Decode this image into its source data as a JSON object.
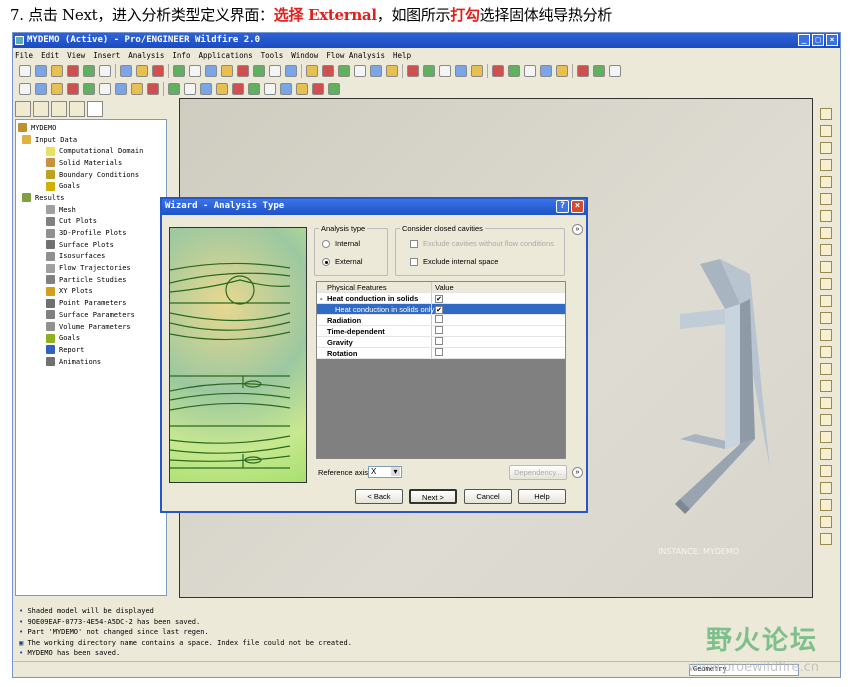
{
  "caption": {
    "prefix": "7. 点击 Next，进入分析类型定义界面：",
    "hl1": "选择 External",
    "mid": "，如图所示",
    "hl2": "打勾",
    "suffix": "选择固体纯导热分析"
  },
  "window": {
    "title": "MYDEMO (Active) - Pro/ENGINEER Wildfire 2.0",
    "controls": [
      "_",
      "□",
      "×"
    ]
  },
  "menu": [
    "File",
    "Edit",
    "View",
    "Insert",
    "Analysis",
    "Info",
    "Applications",
    "Tools",
    "Window",
    "Flow Analysis",
    "Help"
  ],
  "tree": {
    "root": "MYDEMO",
    "items": [
      {
        "label": "Input Data",
        "level": 1,
        "color": "#e0b040"
      },
      {
        "label": "Computational Domain",
        "level": 2,
        "color": "#e8e060"
      },
      {
        "label": "Solid Materials",
        "level": 2,
        "color": "#c89040"
      },
      {
        "label": "Boundary Conditions",
        "level": 2,
        "color": "#c0a020"
      },
      {
        "label": "Goals",
        "level": 2,
        "color": "#d0b000"
      },
      {
        "label": "Results",
        "level": 1,
        "color": "#80a040"
      },
      {
        "label": "Mesh",
        "level": 2,
        "color": "#a0a0a0"
      },
      {
        "label": "Cut Plots",
        "level": 2,
        "color": "#808080"
      },
      {
        "label": "3D-Profile Plots",
        "level": 2,
        "color": "#909090"
      },
      {
        "label": "Surface Plots",
        "level": 2,
        "color": "#707070"
      },
      {
        "label": "Isosurfaces",
        "level": 2,
        "color": "#909090"
      },
      {
        "label": "Flow Trajectories",
        "level": 2,
        "color": "#a0a0a0"
      },
      {
        "label": "Particle Studies",
        "level": 2,
        "color": "#808080"
      },
      {
        "label": "XY Plots",
        "level": 2,
        "color": "#d0a020"
      },
      {
        "label": "Point Parameters",
        "level": 2,
        "color": "#707070"
      },
      {
        "label": "Surface Parameters",
        "level": 2,
        "color": "#808080"
      },
      {
        "label": "Volume Parameters",
        "level": 2,
        "color": "#909090"
      },
      {
        "label": "Goals",
        "level": 2,
        "color": "#90b020"
      },
      {
        "label": "Report",
        "level": 2,
        "color": "#3060c0"
      },
      {
        "label": "Animations",
        "level": 2,
        "color": "#707070"
      }
    ]
  },
  "graphics": {
    "instance": "INSTANCE: MYDEMO"
  },
  "messages": [
    "Shaded model will be displayed",
    "9OE09EAF-0773-4E54-A5DC-2 has been saved.",
    "Part 'MYDEMO' not changed since last regen.",
    "The working directory name contains a space. Index file could not be created.",
    "MYDEMO has been saved."
  ],
  "status": {
    "filter": "Geometry"
  },
  "watermark": {
    "text": "野火论坛",
    "url": "www.proewildfire.cn"
  },
  "dialog": {
    "title": "Wizard - Analysis Type",
    "analysis_type": {
      "legend": "Analysis type",
      "internal": "Internal",
      "external": "External",
      "selected": "External"
    },
    "cavities": {
      "legend": "Consider closed cavities",
      "opt1": "Exclude cavities without flow conditions",
      "opt2": "Exclude internal space"
    },
    "grid": {
      "headers": [
        "Physical Features",
        "Value"
      ],
      "rows": [
        {
          "label": "Heat conduction in solids",
          "checked": true,
          "expander": "-"
        },
        {
          "label": "Heat conduction in solids only",
          "checked": true,
          "selected": true
        },
        {
          "label": "Radiation",
          "checked": false
        },
        {
          "label": "Time-dependent",
          "checked": false
        },
        {
          "label": "Gravity",
          "checked": false
        },
        {
          "label": "Rotation",
          "checked": false
        }
      ]
    },
    "reference_axis_label": "Reference axis:",
    "reference_axis": "X",
    "buttons": {
      "dependency": "Dependency...",
      "back": "< Back",
      "next": "Next >",
      "cancel": "Cancel",
      "help": "Help"
    }
  }
}
